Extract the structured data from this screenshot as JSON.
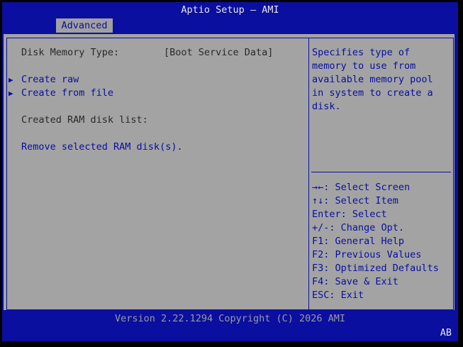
{
  "title": "Aptio Setup – AMI",
  "tabs": [
    {
      "label": "Advanced"
    }
  ],
  "settings": {
    "disk_memory_type_label": "Disk Memory Type:",
    "disk_memory_type_value": "[Boot Service Data]",
    "create_raw": "Create raw",
    "create_from_file": "Create from file",
    "created_list_label": "Created RAM disk list:",
    "remove_selected": "Remove selected RAM disk(s)."
  },
  "help": {
    "lines": [
      "Specifies type of",
      "memory to use from",
      "available memory pool",
      "in system to create a",
      "disk."
    ]
  },
  "keys": [
    {
      "key": "→←",
      "desc": ": Select Screen"
    },
    {
      "key": "↑↓",
      "desc": ": Select Item"
    },
    {
      "key": "Enter",
      "desc": ": Select"
    },
    {
      "key": "+/-",
      "desc": ": Change Opt."
    },
    {
      "key": "F1",
      "desc": ": General Help"
    },
    {
      "key": "F2",
      "desc": ": Previous Values"
    },
    {
      "key": "F3",
      "desc": ": Optimized Defaults"
    },
    {
      "key": "F4",
      "desc": ": Save & Exit"
    },
    {
      "key": "ESC",
      "desc": ": Exit"
    }
  ],
  "footer": "Version 2.22.1294 Copyright (C) 2026 AMI",
  "corner_code": "AB",
  "colors": {
    "bios_blue": "#0a0fa0",
    "panel_gray": "#a3a3a3",
    "title_white": "#e6e6e6"
  }
}
